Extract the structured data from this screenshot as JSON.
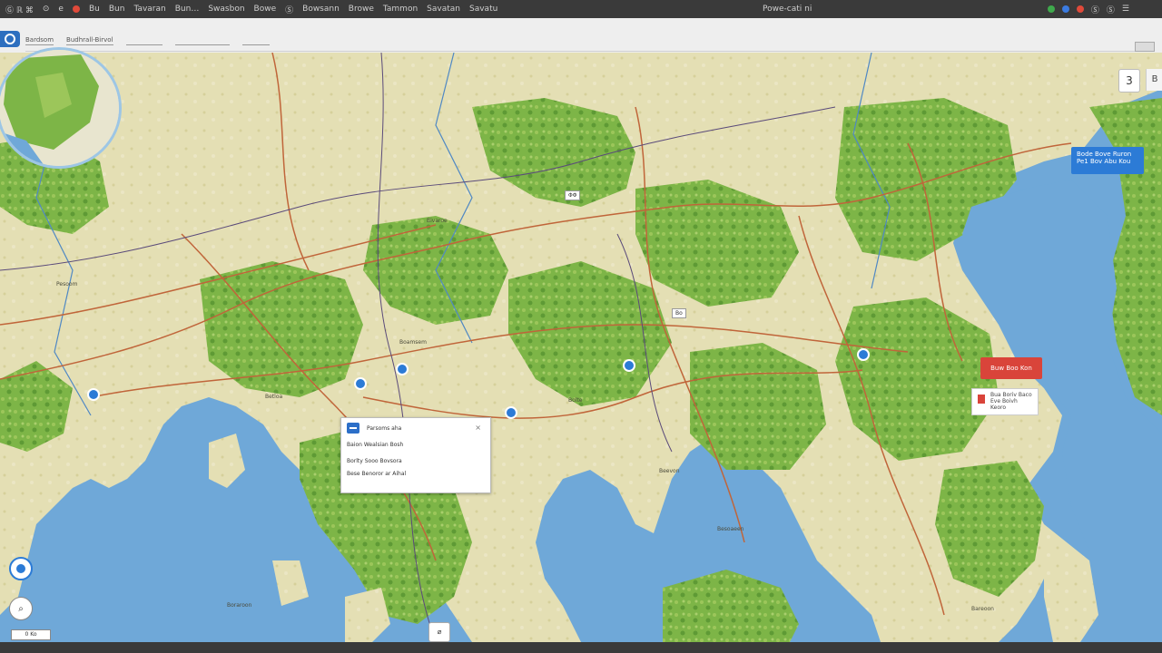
{
  "system_bar": {
    "left_items": [
      "Ⓖ ℝ ⌘",
      "⊙",
      "e",
      "Ⓢ",
      "Bu",
      "Bun",
      "Tavaran",
      "Bun…",
      "Swasbon",
      "Bowe",
      "Ⓢ",
      "Bowsann",
      "Browe",
      "Tammon",
      "Savatan",
      "Savatu"
    ],
    "center_text": "Powe-cati ni",
    "right_items": [
      "Ⓟ",
      "Ⓑ",
      "Ⓖ",
      "Ⓢ",
      "Ⓢ",
      "☰"
    ]
  },
  "toolbar": {
    "tabs": [
      "Bardsom",
      "Budhrall-Birvol",
      "",
      "",
      ""
    ],
    "close_label": ""
  },
  "map": {
    "water_color": "#6fa8d8",
    "land_color": "#e4dfb4",
    "forest_color": "#7db547",
    "road_color": "#c0653a",
    "border_color": "#5a4a7a"
  },
  "controls": {
    "zoom_label": "3",
    "zoom_side": "B",
    "compass_label": "⌀",
    "search_label": "⌕",
    "scale_label": "0 Ko"
  },
  "cards": {
    "blue": {
      "line1": "Bode  Bove Ruron",
      "line2": "Pe1  Bov  Abu  Kou"
    },
    "red": {
      "label": "Buw Boo Kon"
    },
    "white": {
      "line1": "Bua Boriv Baco",
      "line2": "Eve Boivh Keoro"
    }
  },
  "popup": {
    "title": "Parsoms  aha",
    "close": "×",
    "row1": "Baion  Wealsian  Bosh",
    "row2": "Borlty  Sooo  Bovsora",
    "row3": "Bese  Benoror ar Aihal"
  },
  "labels": {
    "a": "Pesoom",
    "b": "Boamsem",
    "c": "Bolte",
    "d": "Beevon",
    "e": "Besoaeen",
    "f": "Betloa",
    "g": "Bivaroe",
    "h": "Boraroon",
    "i": "Bareoon",
    "tag1": "ΦΦ",
    "tag2": "Bo"
  }
}
